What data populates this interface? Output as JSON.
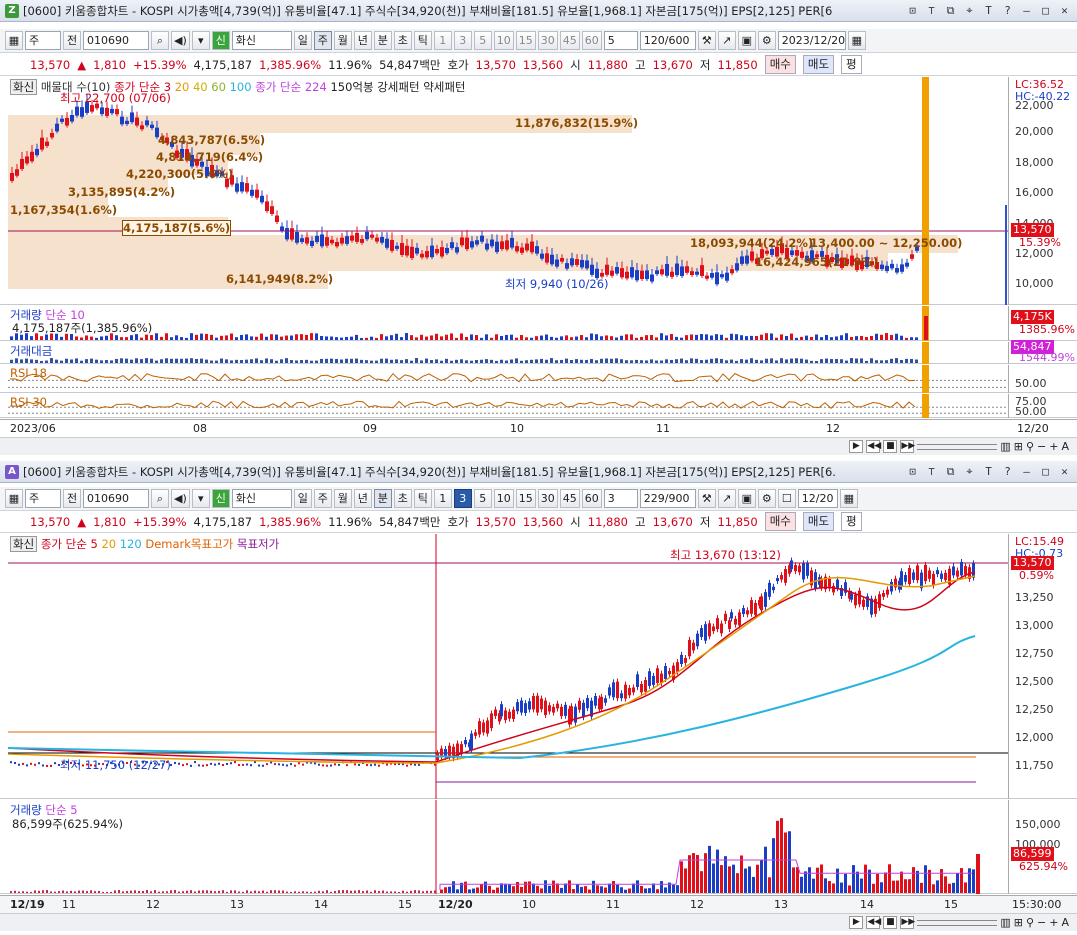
{
  "window1": {
    "badge": "Z",
    "badge_color": "#3c9a3c",
    "title": "[0600] 키움종합차트 - KOSPI 시가총액[4,739(억)] 유통비율[47.1] 주식수[34,920(천)] 부채비율[181.5] 유보율[1,968.1] 자본금[175(억)] EPS[2,125] PER[6",
    "controls": [
      "⊡",
      "⊤",
      "⬚",
      "⌖",
      "T",
      "?",
      "—",
      "□",
      "✕"
    ],
    "toolbar": {
      "type_value": "주",
      "prev_label": "전",
      "code_value": "010690",
      "name_value": "화신",
      "period_buttons": [
        "일",
        "주",
        "월",
        "년",
        "분",
        "초",
        "틱"
      ],
      "active_period": "주",
      "minute_buttons": [
        "1",
        "3",
        "5",
        "10",
        "15",
        "30",
        "45",
        "60"
      ],
      "num_value": "5",
      "count_value": "120/600",
      "date_value": "2023/12/20"
    },
    "quote": {
      "price": "13,570",
      "change": "1,810",
      "change_pct": "+15.39%",
      "volume": "4,175,187",
      "volume_pct": "1,385.96%",
      "turnover": "11.96%",
      "amount": "54,847백만",
      "ask_label": "호가",
      "ask": "13,570",
      "bid": "13,560",
      "open_label": "시",
      "open": "11,880",
      "high_label": "고",
      "high": "13,670",
      "low_label": "저",
      "low": "11,850",
      "buy_label": "매수",
      "sell_label": "매도",
      "eval_label": "평"
    },
    "legend": {
      "name": "화신",
      "item1": "매물대 수(10)",
      "item2": "종가 단순 3",
      "ma": [
        "20",
        "40",
        "60",
        "100"
      ],
      "item3": "종가 단순",
      "item3_val": "224",
      "item4": "150억봉 강세패턴",
      "item5": "약세패턴"
    },
    "lc": "LC:36.52",
    "hc": "HC:-40.22",
    "high_label": "최고 22,700 (07/06)",
    "low_label": "최저 9,940 (10/26)",
    "price_axis": [
      "22,000",
      "20,000",
      "18,000",
      "16,000",
      "14,000",
      "12,000",
      "10,000"
    ],
    "current_price_tag": "13,570",
    "current_pct_tag": "15.39%",
    "volume_profile": [
      "11,876,832(15.9%)",
      "4,843,787(6.5%)",
      "4,814,719(6.4%)",
      "4,220,300(5.6%)",
      "3,135,895(4.2%)",
      "1,167,354(1.6%)",
      "4,175,187(5.6%)",
      "18,093,944(24.2%)",
      "16,424,965(21.9%)",
      "6,141,949(8.2%)"
    ],
    "price_range_label": "13,400.00 ~ 12,250.00)",
    "volume_pane": {
      "title": "거래량",
      "ma": "단순 10",
      "value": "4,175,187주(1,385.96%)",
      "tag": "4,175K",
      "tag_pct": "1385.96%"
    },
    "amount_pane": {
      "title": "거래대금",
      "tag": "54,847",
      "tag_pct": "1544.99%"
    },
    "rsi18": {
      "title": "RSI 18",
      "tick": "50.00"
    },
    "rsi30": {
      "title": "RSI 30",
      "tick1": "75.00",
      "tick2": "50.00"
    },
    "x_labels": [
      "2023/06",
      "08",
      "09",
      "10",
      "11",
      "12",
      "12/20"
    ]
  },
  "window2": {
    "badge": "A",
    "badge_color": "#7a56c8",
    "title": "[0600] 키움종합차트 - KOSPI 시가총액[4,739(억)] 유통비율[47.1] 주식수[34,920(천)] 부채비율[181.5] 유보율[1,968.1] 자본금[175(억)] EPS[2,125] PER[6.",
    "toolbar": {
      "type_value": "주",
      "prev_label": "전",
      "code_value": "010690",
      "name_value": "화신",
      "active_period": "분",
      "active_minute": "3",
      "num_value": "3",
      "count_value": "229/900",
      "date_value": "12/20"
    },
    "legend": {
      "name": "화신",
      "item1": "종가 단순 5",
      "ma": [
        "20",
        "120"
      ],
      "item2": "Demark목표고가",
      "item3": "목표저가"
    },
    "lc": "LC:15.49",
    "hc": "HC:-0.73",
    "high_label": "최고 13,670 (13:12)",
    "low_label": "최저 11,750 (12/27)",
    "price_axis": [
      "13,500",
      "13,250",
      "13,000",
      "12,750",
      "12,500",
      "12,250",
      "12,000",
      "11,750"
    ],
    "current_price_tag": "13,570",
    "current_pct_tag": "0.59%",
    "volume_pane": {
      "title": "거래량",
      "ma": "단순 5",
      "value": "86,599주(625.94%)",
      "tag": "86,599",
      "tag_pct": "625.94%",
      "ticks": [
        "150,000",
        "100,000",
        "50,000"
      ]
    },
    "x_labels": [
      "12/19",
      "11",
      "12",
      "13",
      "14",
      "15",
      "12/20",
      "10",
      "11",
      "12",
      "13",
      "14",
      "15",
      "15:30:00"
    ]
  }
}
